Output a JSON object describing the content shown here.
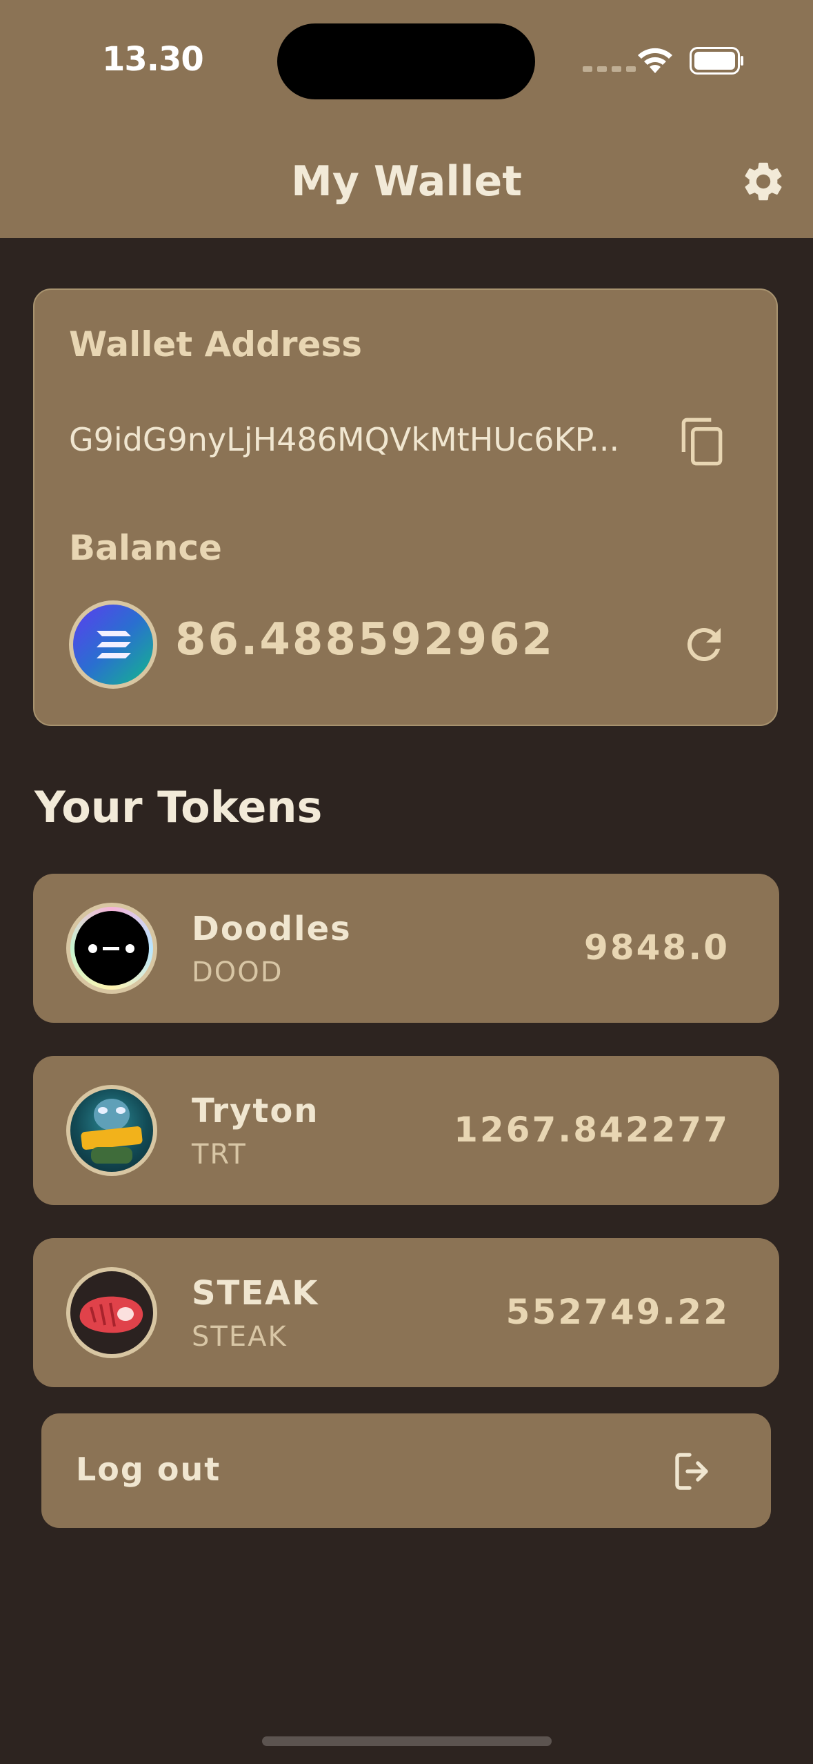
{
  "status_bar": {
    "time": "13.30"
  },
  "header": {
    "title": "My Wallet",
    "settings_icon": "gear-icon"
  },
  "wallet": {
    "address_label": "Wallet Address",
    "address": "G9idG9nyLjH486MQVkMtHUc6KP...",
    "balance_label": "Balance",
    "balance": "86.488592962",
    "copy_icon": "copy-icon",
    "refresh_icon": "refresh-icon"
  },
  "tokens": {
    "title": "Your Tokens",
    "items": [
      {
        "name": "Doodles",
        "symbol": "DOOD",
        "balance": "9848.0"
      },
      {
        "name": "Tryton",
        "symbol": "TRT",
        "balance": "1267.842277"
      },
      {
        "name": "STEAK",
        "symbol": "STEAK",
        "balance": "552749.22"
      }
    ]
  },
  "logout": {
    "label": "Log out",
    "icon": "logout-icon"
  },
  "colors": {
    "header_bg": "#8b7355",
    "page_bg": "#2d2420",
    "card_bg": "#8b7355",
    "text_light": "#f0e6d0"
  }
}
